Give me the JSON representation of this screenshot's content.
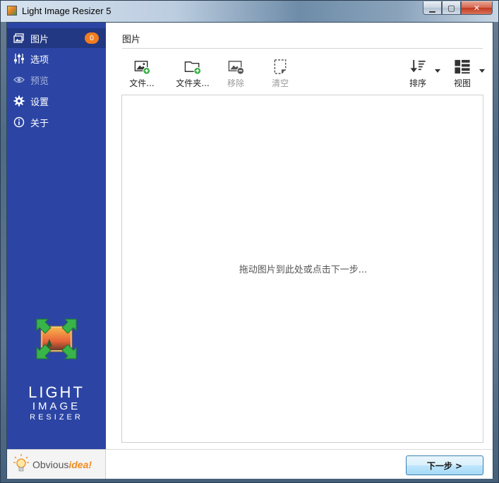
{
  "window": {
    "title": "Light Image Resizer 5",
    "minimize_glyph": "▁",
    "maximize_glyph": "▢",
    "close_glyph": "✕"
  },
  "sidebar": {
    "items": [
      {
        "label": "图片",
        "icon": "images-icon",
        "active": true,
        "badge": "0"
      },
      {
        "label": "选项",
        "icon": "sliders-icon"
      },
      {
        "label": "预览",
        "icon": "eye-icon",
        "disabled": true
      },
      {
        "label": "设置",
        "icon": "gear-icon"
      },
      {
        "label": "关于",
        "icon": "info-icon"
      }
    ],
    "logo_line1": "LIGHT",
    "logo_line2": "IMAGE",
    "logo_line3": "RESIZER",
    "brand_plain": "Obvious",
    "brand_accent": "idea!"
  },
  "main": {
    "title": "图片",
    "toolbar": {
      "add_files": "文件...",
      "add_folder": "文件夹...",
      "remove": "移除",
      "clear": "清空",
      "sort": "排序",
      "view": "视图"
    },
    "drop_hint": "拖动图片到此处或点击下一步..."
  },
  "footer": {
    "next_label": "下一步 >"
  },
  "colors": {
    "sidebar": "#2c45a4",
    "sidebar_active": "#223883",
    "badge": "#f07d1f",
    "add_green": "#2fae3c"
  }
}
